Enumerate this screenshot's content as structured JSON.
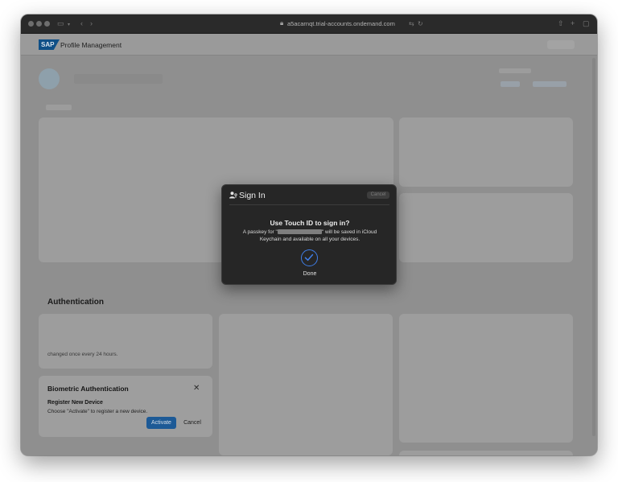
{
  "browser": {
    "url": "a5acarnqt.trial-accounts.ondemand.com"
  },
  "header": {
    "logo_text": "SAP",
    "app_title": "Profile Management"
  },
  "sections": {
    "authentication_title": "Authentication"
  },
  "background": {
    "password_text_fragment": "changed once every 24 hours."
  },
  "biometric_card": {
    "title": "Biometric Authentication",
    "close_glyph": "✕",
    "subtitle": "Register New Device",
    "description": "Choose \"Activate\" to register a new device.",
    "activate_label": "Activate",
    "cancel_label": "Cancel"
  },
  "dialog": {
    "title": "Sign In",
    "cancel_label": "Cancel",
    "heading": "Use Touch ID to sign in?",
    "message_prefix": "A passkey for \"",
    "message_suffix": "\" will be saved in iCloud Keychain and available on all your devices.",
    "status": "Done"
  },
  "colors": {
    "accent_blue": "#3f7ee8",
    "activate_button": "#1d5a96",
    "dialog_bg": "#262626"
  }
}
